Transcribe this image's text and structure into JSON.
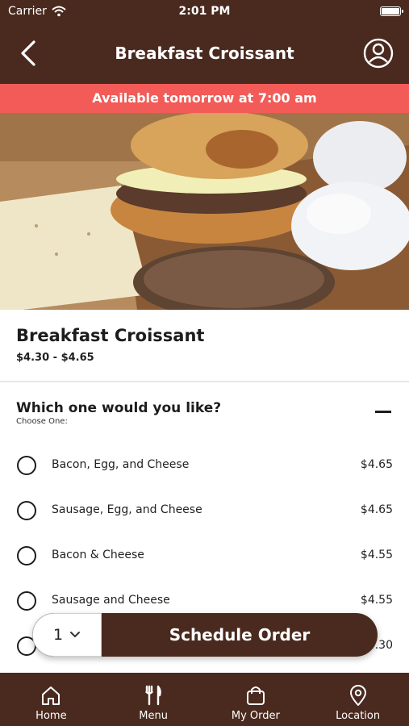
{
  "status": {
    "carrier": "Carrier",
    "time": "2:01 PM"
  },
  "nav": {
    "title": "Breakfast Croissant"
  },
  "banner": {
    "text": "Available tomorrow at 7:00 am"
  },
  "product": {
    "name": "Breakfast Croissant",
    "price_range": "$4.30 - $4.65"
  },
  "options": {
    "question": "Which one would you like?",
    "hint": "Choose One:",
    "items": [
      {
        "label": "Bacon, Egg, and Cheese",
        "price": "$4.65"
      },
      {
        "label": "Sausage, Egg, and Cheese",
        "price": "$4.65"
      },
      {
        "label": "Bacon & Cheese",
        "price": "$4.55"
      },
      {
        "label": "Sausage and Cheese",
        "price": "$4.55"
      },
      {
        "label": "",
        "price": "$4.30"
      }
    ]
  },
  "order": {
    "quantity": "1",
    "cta": "Schedule Order"
  },
  "tabs": [
    {
      "label": "Home",
      "icon": "home-icon"
    },
    {
      "label": "Menu",
      "icon": "fork-knife-icon"
    },
    {
      "label": "My Order",
      "icon": "bag-icon"
    },
    {
      "label": "Location",
      "icon": "location-pin-icon"
    }
  ],
  "colors": {
    "brand": "#4a2a1f",
    "banner": "#f25b57"
  }
}
